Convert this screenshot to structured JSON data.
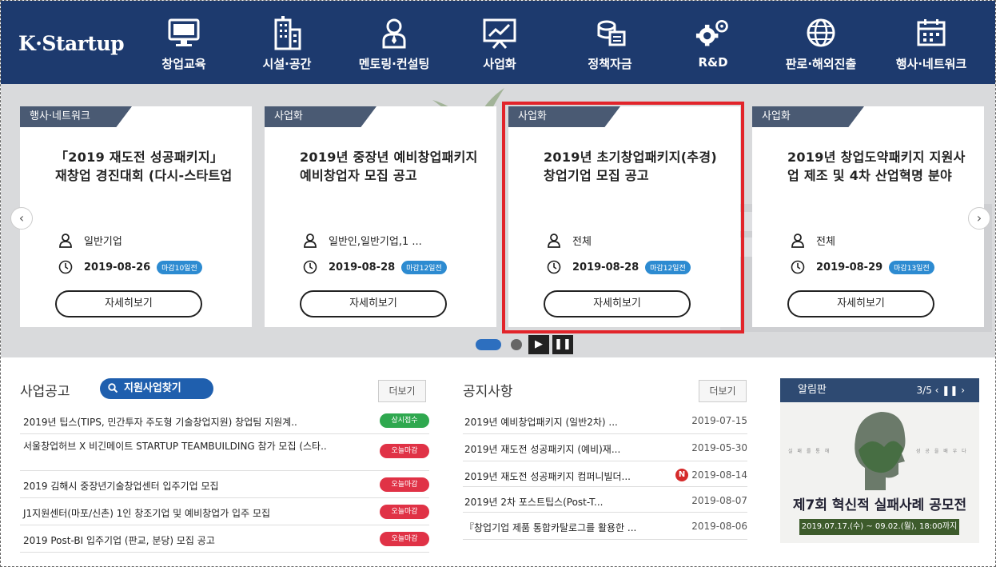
{
  "header": {
    "logo": "K·Startup",
    "nav": [
      {
        "label": "창업교육",
        "icon": "monitor-icon"
      },
      {
        "label": "시설·공간",
        "icon": "building-icon"
      },
      {
        "label": "멘토링·컨설팅",
        "icon": "mentor-icon"
      },
      {
        "label": "사업화",
        "icon": "presentation-chart-icon"
      },
      {
        "label": "정책자금",
        "icon": "money-icon"
      },
      {
        "label": "R&D",
        "icon": "gears-icon"
      },
      {
        "label": "판로·해외진출",
        "icon": "globe-icon"
      },
      {
        "label": "행사·네트워크",
        "icon": "calendar-icon"
      }
    ],
    "colors": {
      "header_bg": "#1d3a6e",
      "highlight": "#e2242a"
    }
  },
  "carousel": {
    "cards": [
      {
        "tag": "행사·네트워크",
        "title": "「2019 재도전 성공패키지」 재창업 경진대회 (다시-스타트업",
        "target": "일반기업",
        "date": "2019-08-26",
        "dday": "마감10일전",
        "button": "자세히보기"
      },
      {
        "tag": "사업화",
        "title": "2019년 중장년 예비창업패키지 예비창업자 모집 공고",
        "target": "일반인,일반기업,1 ...",
        "date": "2019-08-28",
        "dday": "마감12일전",
        "button": "자세히보기"
      },
      {
        "tag": "사업화",
        "title": "2019년 초기창업패키지(추경) 창업기업 모집 공고",
        "target": "전체",
        "date": "2019-08-28",
        "dday": "마감12일전",
        "button": "자세히보기"
      },
      {
        "tag": "사업화",
        "title": "2019년 창업도약패키지 지원사업 제조 및 4차 산업혁명 분야",
        "target": "전체",
        "date": "2019-08-29",
        "dday": "마감13일전",
        "button": "자세히보기"
      }
    ],
    "prev": "‹",
    "next": "›",
    "play": "▶",
    "pause": "❚❚"
  },
  "business": {
    "title": "사업공고",
    "search_button": "지원사업찾기",
    "more": "더보기",
    "items": [
      {
        "text": "2019년 팁스(TIPS, 민간투자 주도형 기술창업지원) 창업팀 지원계..",
        "badge": "상시접수",
        "badge_color": "green"
      },
      {
        "text": "서울창업허브 X 비긴메이트 STARTUP TEAMBUILDING 참가 모집 (스타..",
        "badge": "오늘마감",
        "badge_color": "red"
      },
      {
        "text": "2019 김해시 중장년기술창업센터 입주기업 모집",
        "badge": "오늘마감",
        "badge_color": "red"
      },
      {
        "text": "J1지원센터(마포/신촌) 1인 창조기업 및 예비창업가 입주 모집",
        "badge": "오늘마감",
        "badge_color": "red"
      },
      {
        "text": "2019 Post-BI 입주기업 (판교, 분당) 모집 공고",
        "badge": "오늘마감",
        "badge_color": "red"
      }
    ]
  },
  "notices": {
    "title": "공지사항",
    "more": "더보기",
    "items": [
      {
        "text": "2019년 예비창업패키지 (일반2차) ...",
        "date": "2019-07-15",
        "new": ""
      },
      {
        "text": "2019년 재도전 성공패키지 (예비)재...",
        "date": "2019-05-30",
        "new": ""
      },
      {
        "text": "2019년 재도전 성공패키지 컴퍼니빌더...",
        "date": "2019-08-14",
        "new": "N"
      },
      {
        "text": "2019년 2차 포스트팁스(Post-T...",
        "date": "2019-08-07",
        "new": ""
      },
      {
        "text": "『창업기업 제품 통합카탈로그를 활용한 ...",
        "date": "2019-08-06",
        "new": ""
      }
    ]
  },
  "board": {
    "title": "알림판",
    "pager": "3/5  ‹  ❚❚  ›",
    "side_left": "실 패 를 통 해",
    "side_right": "성 공 을 배 우 다",
    "headline": "제7회 혁신적 실패사례 공모전",
    "period": "2019.07.17.(수) ~ 09.02.(월), 18:00까지"
  }
}
